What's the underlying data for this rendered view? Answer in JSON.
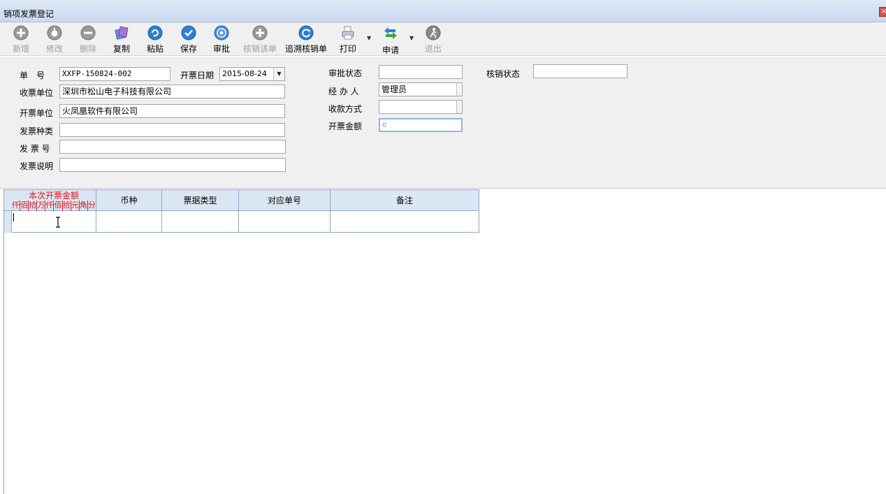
{
  "window": {
    "title": "销项发票登记",
    "close_glyph": "×"
  },
  "toolbar": {
    "buttons": [
      {
        "label": "新增",
        "icon": "plus-circle-icon",
        "enabled": false
      },
      {
        "label": "修改",
        "icon": "edit-circle-icon",
        "enabled": false
      },
      {
        "label": "删除",
        "icon": "minus-circle-icon",
        "enabled": false
      },
      {
        "label": "复制",
        "icon": "copy-icon",
        "enabled": true
      },
      {
        "label": "粘贴",
        "icon": "paste-icon",
        "enabled": true
      },
      {
        "label": "保存",
        "icon": "save-check-icon",
        "enabled": true
      },
      {
        "label": "审批",
        "icon": "approve-icon",
        "enabled": true
      },
      {
        "label": "核销该单",
        "icon": "writeoff-icon",
        "enabled": false
      },
      {
        "label": "追溯核销单",
        "icon": "trace-icon",
        "enabled": true
      },
      {
        "label": "打印",
        "icon": "printer-icon",
        "enabled": true
      },
      {
        "label": "申请",
        "icon": "apply-arrows-icon",
        "enabled": true
      },
      {
        "label": "退出",
        "icon": "exit-icon",
        "enabled": false
      }
    ],
    "dropdown_glyph": "▼"
  },
  "form": {
    "order_no_label": "单　号",
    "order_no_value": "XXFP-150824-002",
    "invoice_date_label": "开票日期",
    "invoice_date_value": "2015-08-24",
    "receiver_label": "收票单位",
    "receiver_value": "深圳市松山电子科技有限公司",
    "issuer_label": "开票单位",
    "issuer_value": "火凤凰软件有限公司",
    "invoice_type_label": "发票种类",
    "invoice_type_value": "",
    "invoice_no_label": "发 票 号",
    "invoice_no_value": "",
    "invoice_desc_label": "发票说明",
    "invoice_desc_value": "",
    "approval_status_label": "审批状态",
    "approval_status_value": "",
    "writeoff_status_label": "核销状态",
    "writeoff_status_value": "",
    "handler_label": "经 办 人",
    "handler_value": "管理员",
    "payment_method_label": "收款方式",
    "payment_method_value": "",
    "invoice_amount_label": "开票金额",
    "invoice_amount_value": "0"
  },
  "grid": {
    "amount_header": "本次开票金额",
    "amount_digits": [
      "仟",
      "佰",
      "拾",
      "万",
      "仟",
      "佰",
      "拾",
      "元",
      "角",
      "分"
    ],
    "columns": [
      "币种",
      "票据类型",
      "对应单号",
      "备注"
    ],
    "rows": [
      {
        "amount": "",
        "currency": "",
        "bill_type": "",
        "ref_no": "",
        "remark": ""
      }
    ]
  },
  "colors": {
    "accent": "#1f6fbf",
    "grid_header_bg": "#dbe6f3",
    "amount_header_text": "#e0151a"
  }
}
